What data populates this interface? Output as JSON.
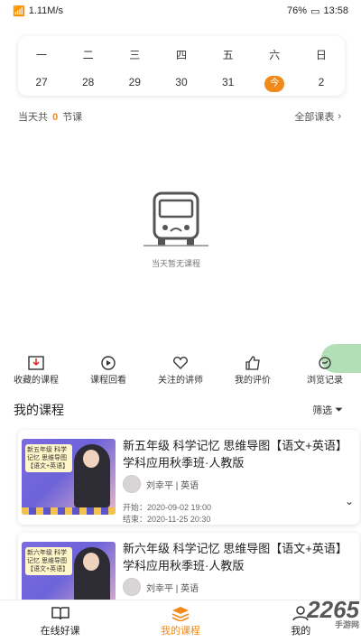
{
  "status": {
    "network": "1.11M/s",
    "battery": "76%",
    "time": "13:58"
  },
  "calendar": {
    "weekdays": [
      "一",
      "二",
      "三",
      "四",
      "五",
      "六",
      "日"
    ],
    "days": [
      "27",
      "28",
      "29",
      "30",
      "31",
      "今",
      "2"
    ]
  },
  "summary": {
    "prefix": "当天共",
    "count": "0",
    "suffix": "节课",
    "all_label": "全部课表"
  },
  "empty": {
    "text": "当天暂无课程"
  },
  "quick": [
    {
      "label": "收藏的课程",
      "icon": "download-icon"
    },
    {
      "label": "课程回看",
      "icon": "replay-icon"
    },
    {
      "label": "关注的讲师",
      "icon": "heart-icon"
    },
    {
      "label": "我的评价",
      "icon": "thumb-up-icon"
    },
    {
      "label": "浏览记录",
      "icon": "history-icon"
    }
  ],
  "section": {
    "title": "我的课程",
    "filter": "筛选"
  },
  "courses": [
    {
      "title": "新五年级 科学记忆 思维导图【语文+英语】学科应用秋季班·人教版",
      "teacher": "刘幸平 | 英语",
      "start": "开始：2020-09-02 19:00",
      "end": "结束：2020-11-25 20:30",
      "thumb_text": "新五年级 科学记忆 思维导图【语文+英语】"
    },
    {
      "title": "新六年级 科学记忆 思维导图【语文+英语】学科应用秋季班·人教版",
      "teacher": "刘幸平 | 英语",
      "thumb_text": "新六年级 科学记忆 思维导图【语文+英语】"
    }
  ],
  "tabs": [
    {
      "label": "在线好课",
      "icon": "book-icon"
    },
    {
      "label": "我的课程",
      "icon": "layers-icon"
    },
    {
      "label": "我的",
      "icon": "person-icon"
    }
  ],
  "watermark": {
    "text": "2265",
    "sub": "手游网"
  },
  "colors": {
    "accent": "#f08a1c"
  }
}
